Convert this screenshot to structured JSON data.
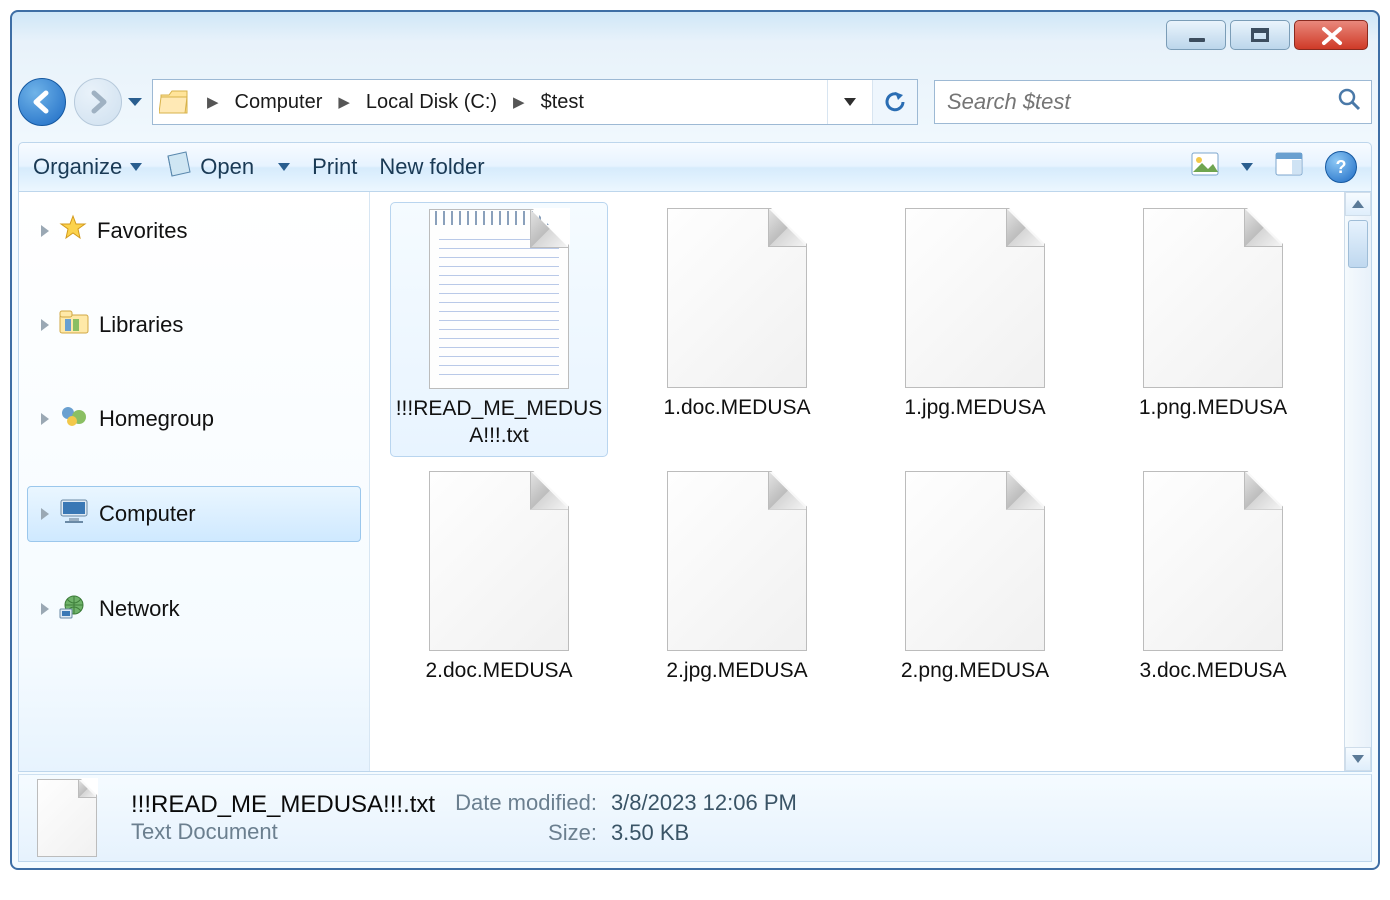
{
  "window_controls": {
    "min": "minimize",
    "max": "maximize",
    "close": "close"
  },
  "address": {
    "folder_icon": "folder",
    "crumbs": [
      "Computer",
      "Local Disk (C:)",
      "$test"
    ],
    "dropdown_icon": "chevron-down",
    "refresh_icon": "refresh"
  },
  "search": {
    "placeholder": "Search $test",
    "icon": "search"
  },
  "toolbar": {
    "organize": "Organize",
    "open": "Open",
    "print": "Print",
    "new_folder": "New folder",
    "view_icon": "image-icon",
    "preview_icon": "preview-pane",
    "help_icon": "help"
  },
  "nav": {
    "items": [
      {
        "id": "favorites",
        "label": "Favorites",
        "icon": "star"
      },
      {
        "id": "libraries",
        "label": "Libraries",
        "icon": "libraries"
      },
      {
        "id": "homegroup",
        "label": "Homegroup",
        "icon": "homegroup"
      },
      {
        "id": "computer",
        "label": "Computer",
        "icon": "computer",
        "selected": true
      },
      {
        "id": "network",
        "label": "Network",
        "icon": "network"
      }
    ]
  },
  "files": [
    {
      "name": "!!!READ_ME_MEDUSA!!!.txt",
      "type": "txt",
      "selected": true
    },
    {
      "name": "1.doc.MEDUSA",
      "type": "blank"
    },
    {
      "name": "1.jpg.MEDUSA",
      "type": "blank"
    },
    {
      "name": "1.png.MEDUSA",
      "type": "blank"
    },
    {
      "name": "2.doc.MEDUSA",
      "type": "blank"
    },
    {
      "name": "2.jpg.MEDUSA",
      "type": "blank"
    },
    {
      "name": "2.png.MEDUSA",
      "type": "blank"
    },
    {
      "name": "3.doc.MEDUSA",
      "type": "blank"
    }
  ],
  "details": {
    "name": "!!!READ_ME_MEDUSA!!!.txt",
    "type": "Text Document",
    "date_modified_label": "Date modified:",
    "date_modified": "3/8/2023 12:06 PM",
    "size_label": "Size:",
    "size": "3.50 KB"
  }
}
